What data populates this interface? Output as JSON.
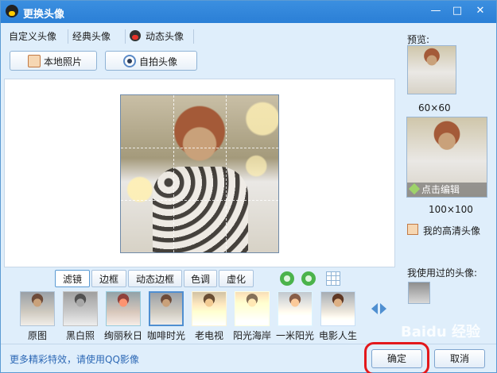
{
  "window": {
    "title": "更换头像",
    "min": "—",
    "max": "□",
    "close": "✕"
  },
  "tabs": [
    "自定义头像",
    "经典头像",
    "动态头像"
  ],
  "actions": {
    "local_photo": "本地照片",
    "self_photo": "自拍头像"
  },
  "filters": {
    "tabs": [
      "滤镜",
      "边框",
      "动态边框",
      "色调",
      "虚化"
    ],
    "active": "滤镜"
  },
  "thumbnails": [
    {
      "label": "原图"
    },
    {
      "label": "黑白照"
    },
    {
      "label": "绚丽秋日"
    },
    {
      "label": "咖啡时光",
      "selected": true
    },
    {
      "label": "老电视"
    },
    {
      "label": "阳光海岸"
    },
    {
      "label": "一米阳光"
    },
    {
      "label": "电影人生"
    }
  ],
  "side": {
    "preview_label": "预览:",
    "size_small": "60×60",
    "size_big": "100×100",
    "edit_text": "点击编辑",
    "hd_label": "我的高清头像",
    "used_label": "我使用过的头像:"
  },
  "bottom": {
    "link": "更多精彩特效，请使用QQ影像",
    "ok": "确定",
    "cancel": "取消"
  },
  "watermark": "Baidu 经验",
  "colors": {
    "title_bar": "#2b7fd6",
    "window_bg": "#dfeefb",
    "highlight": "#e3181c"
  }
}
